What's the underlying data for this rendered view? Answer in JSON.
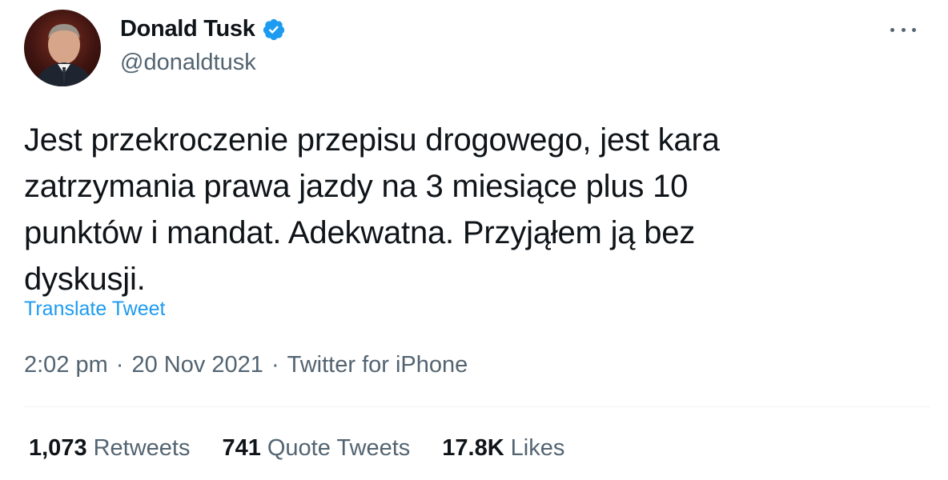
{
  "author": {
    "display_name": "Donald Tusk",
    "handle": "@donaldtusk",
    "verified_icon": "verified-badge-icon",
    "verified_color": "#1d9bf0"
  },
  "tweet": {
    "text": "Jest przekroczenie przepisu drogowego, jest kara\nzatrzymania prawa jazdy na 3 miesiące plus 10\npunktów i mandat. Adekwatna. Przyjąłem ją bez\ndyskusji.",
    "translate_label": "Translate Tweet",
    "time": "2:02 pm",
    "separator": "·",
    "date": "20 Nov 2021",
    "source": "Twitter for iPhone"
  },
  "stats": {
    "retweets_count": "1,073",
    "retweets_label": "Retweets",
    "quotes_count": "741",
    "quotes_label": "Quote Tweets",
    "likes_count": "17.8K",
    "likes_label": "Likes"
  },
  "colors": {
    "text": "#0f1419",
    "secondary": "#536471",
    "link": "#1d9bf0",
    "divider": "#eff3f4"
  }
}
